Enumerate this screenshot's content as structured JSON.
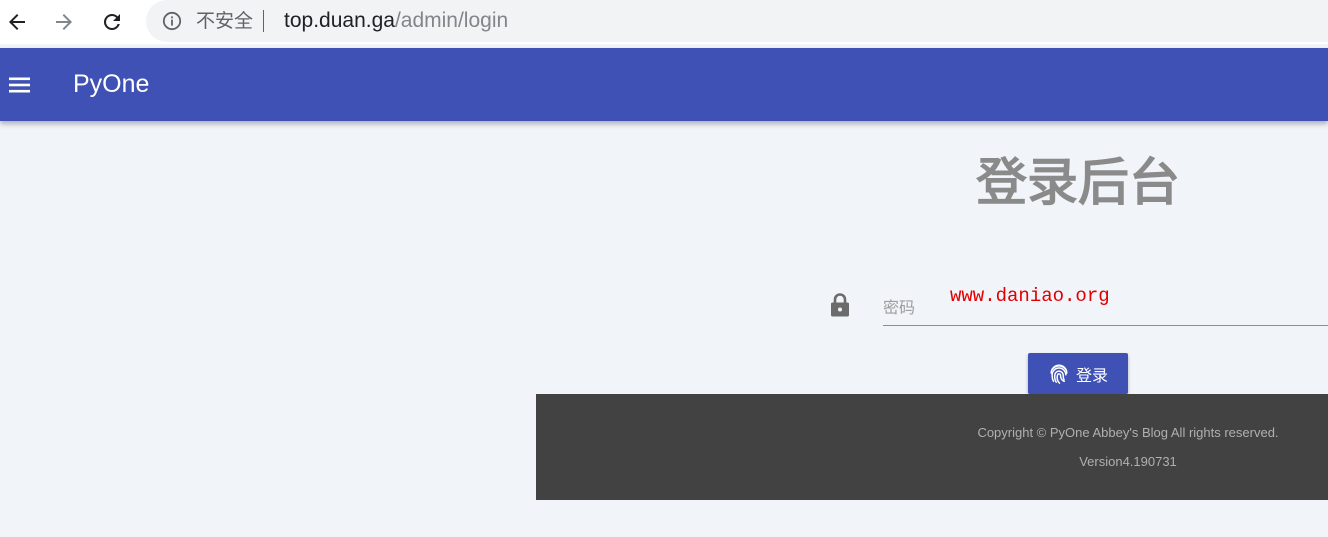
{
  "browser": {
    "security_label": "不安全",
    "url_host": "top.duan.ga",
    "url_path": "/admin/login"
  },
  "header": {
    "title": "PyOne"
  },
  "login": {
    "title": "登录后台",
    "password_label": "密码",
    "password_value": "www.daniao.org",
    "submit_label": "登录"
  },
  "footer": {
    "copyright": "Copyright © PyOne Abbey's Blog All rights reserved.",
    "version": "Version4.190731"
  },
  "colors": {
    "primary": "#3f51b5",
    "footer_bg": "#424242",
    "page_bg": "#f1f4f9",
    "watermark": "#e00000"
  }
}
